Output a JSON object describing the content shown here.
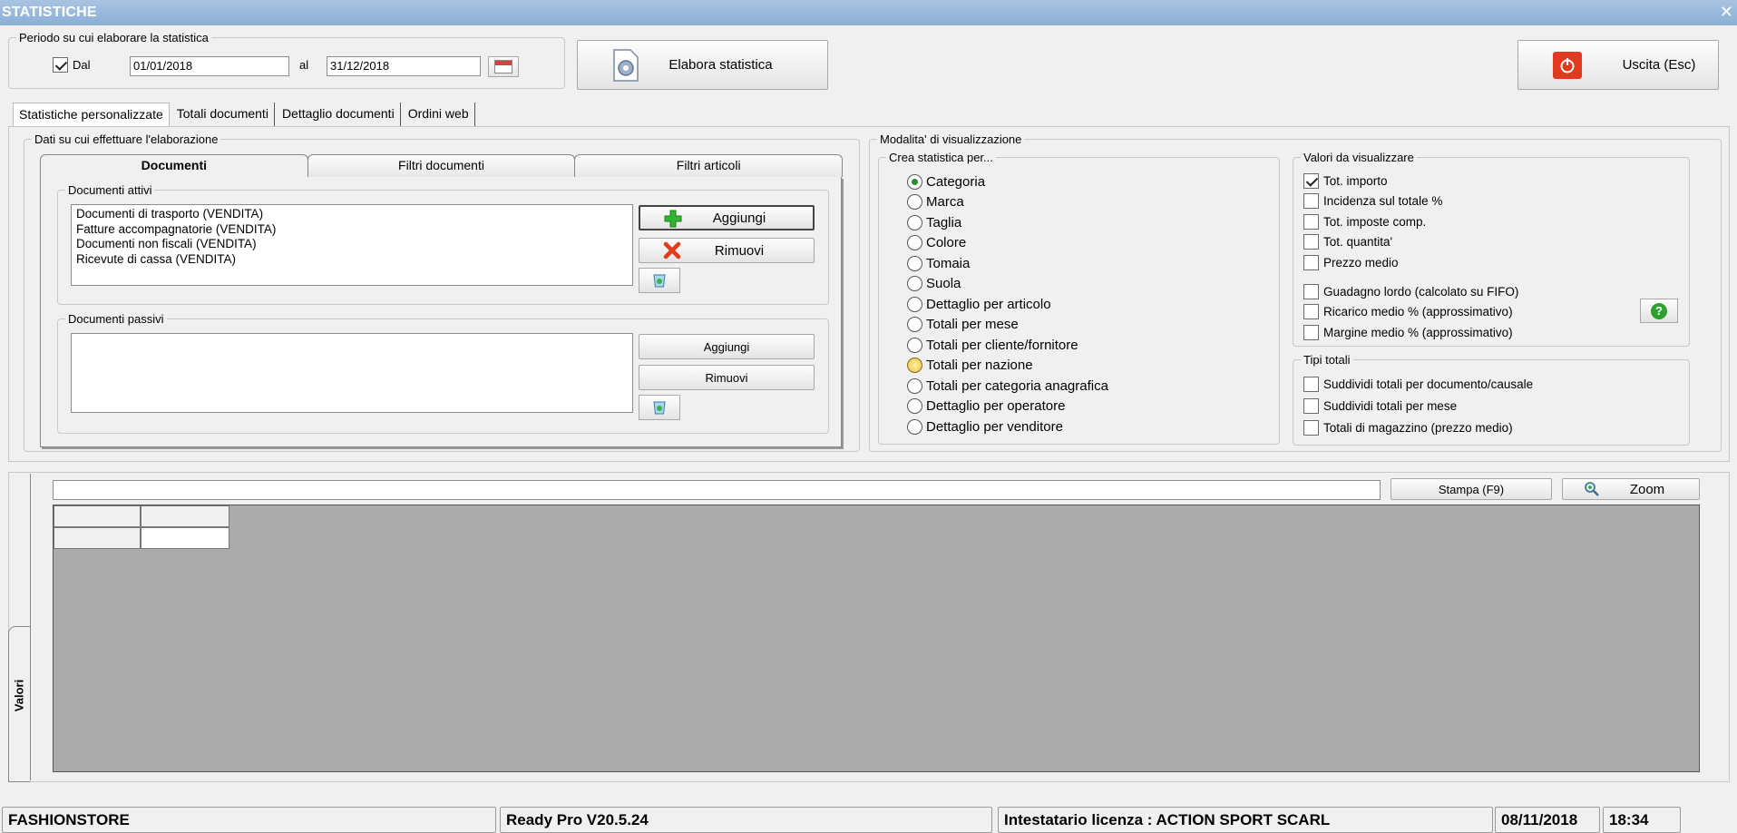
{
  "window": {
    "title": "STATISTICHE"
  },
  "period": {
    "legend": "Periodo su cui elaborare la statistica",
    "from_label": "Dal",
    "from_checked": true,
    "from_value": "01/01/2018",
    "to_label": "al",
    "to_value": "31/12/2018"
  },
  "toolbar": {
    "elabora_label": "Elabora statistica",
    "exit_label": "Uscita (Esc)"
  },
  "tabs": [
    "Statistiche personalizzate",
    "Totali documenti",
    "Dettaglio documenti",
    "Ordini web"
  ],
  "data_section": {
    "legend": "Dati su cui effettuare l'elaborazione",
    "subtabs": [
      "Documenti",
      "Filtri documenti",
      "Filtri articoli"
    ],
    "active": {
      "legend": "Documenti attivi",
      "items": [
        "Documenti di trasporto (VENDITA)",
        "Fatture accompagnatorie (VENDITA)",
        "Documenti non fiscali (VENDITA)",
        "Ricevute di cassa (VENDITA)"
      ],
      "add_label": "Aggiungi",
      "remove_label": "Rimuovi"
    },
    "passive": {
      "legend": "Documenti passivi",
      "items": [],
      "add_label": "Aggiungi",
      "remove_label": "Rimuovi"
    }
  },
  "display_mode": {
    "legend": "Modalita' di visualizzazione",
    "create": {
      "legend": "Crea statistica per...",
      "options": [
        "Categoria",
        "Marca",
        "Taglia",
        "Colore",
        "Tomaia",
        "Suola",
        "Dettaglio per articolo",
        "Totali per mese",
        "Totali per cliente/fornitore",
        "Totali per nazione",
        "Totali per categoria anagrafica",
        "Dettaglio per operatore",
        "Dettaglio per venditore"
      ],
      "selected": "Categoria",
      "highlighted": "Totali per nazione"
    },
    "values": {
      "legend": "Valori da visualizzare",
      "group1": [
        {
          "label": "Tot. importo",
          "checked": true
        },
        {
          "label": "Incidenza sul totale %",
          "checked": false
        },
        {
          "label": "Tot. imposte comp.",
          "checked": false
        },
        {
          "label": "Tot. quantita'",
          "checked": false
        },
        {
          "label": "Prezzo medio",
          "checked": false
        }
      ],
      "group2": [
        {
          "label": "Guadagno lordo (calcolato su FIFO)",
          "checked": false
        },
        {
          "label": "Ricarico medio % (approssimativo)",
          "checked": false
        },
        {
          "label": "Margine medio % (approssimativo)",
          "checked": false
        }
      ]
    },
    "totals": {
      "legend": "Tipi totali",
      "items": [
        {
          "label": "Suddividi totali per documento/causale",
          "checked": false
        },
        {
          "label": "Suddividi totali per mese",
          "checked": false
        },
        {
          "label": "Totali di magazzino (prezzo medio)",
          "checked": false
        }
      ]
    }
  },
  "results": {
    "side_tab": "Valori",
    "print_label": "Stampa (F9)",
    "zoom_label": "Zoom",
    "search_value": ""
  },
  "status": {
    "company": "FASHIONSTORE",
    "version": "Ready Pro V20.5.24",
    "license": "Intestatario licenza : ACTION SPORT SCARL",
    "date": "08/11/2018",
    "time": "18:34"
  },
  "colors": {
    "title_bar": "#8aafd6",
    "grid_bg": "#ababab",
    "radio_selected": "#2d8a2d",
    "exit_icon": "#e03a20",
    "add_icon": "#2fb52f",
    "remove_icon": "#e23a1c"
  }
}
